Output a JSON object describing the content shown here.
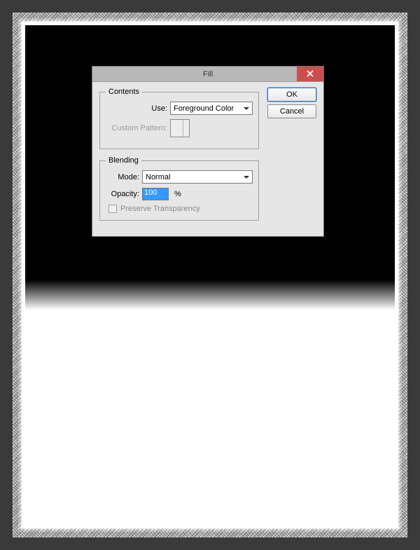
{
  "dialog": {
    "title": "Fill",
    "buttons": {
      "ok": "OK",
      "cancel": "Cancel"
    },
    "contents": {
      "legend": "Contents",
      "use_label": "Use:",
      "use_value": "Foreground Color",
      "pattern_label": "Custom Pattern:"
    },
    "blending": {
      "legend": "Blending",
      "mode_label": "Mode:",
      "mode_value": "Normal",
      "opacity_label": "Opacity:",
      "opacity_value": "100",
      "opacity_unit": "%",
      "preserve_label": "Preserve Transparency"
    }
  }
}
